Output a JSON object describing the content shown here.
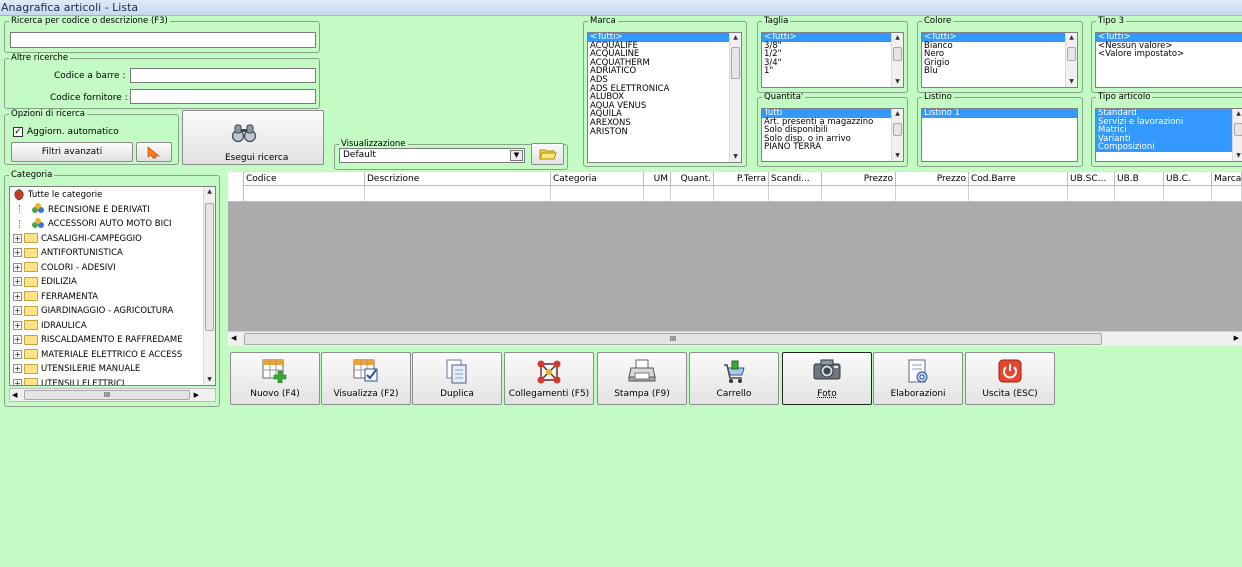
{
  "window": {
    "title": "Anagrafica articoli  - Lista"
  },
  "search": {
    "legend": "Ricerca per codice o descrizione (F3)",
    "value": ""
  },
  "other": {
    "legend": "Altre ricerche",
    "barcode_label": "Codice a barre :",
    "barcode_value": "",
    "supplier_label": "Codice fornitore :",
    "supplier_value": ""
  },
  "options": {
    "legend": "Opzioni di ricerca",
    "auto_update_label": "Aggiorn. automatico",
    "auto_update_checked": true,
    "advanced_filters_label": "Filtri avanzati"
  },
  "search_button_label": "Esegui ricerca",
  "view": {
    "legend": "Visualizzazione",
    "selected": "Default"
  },
  "category": {
    "legend": "Categoria",
    "items": [
      {
        "label": "Tutte le categorie",
        "type": "root"
      },
      {
        "label": "RECINSIONE E DERIVATI",
        "type": "special"
      },
      {
        "label": "ACCESSORI AUTO MOTO BICI",
        "type": "special"
      },
      {
        "label": "CASALIGHI-CAMPEGGIO",
        "type": "folder"
      },
      {
        "label": "ANTIFORTUNISTICA",
        "type": "folder"
      },
      {
        "label": "COLORI - ADESIVI",
        "type": "folder"
      },
      {
        "label": "EDILIZIA",
        "type": "folder"
      },
      {
        "label": "FERRAMENTA",
        "type": "folder"
      },
      {
        "label": "GIARDINAGGIO - AGRICOLTURA",
        "type": "folder"
      },
      {
        "label": "IDRAULICA",
        "type": "folder"
      },
      {
        "label": "RISCALDAMENTO E RAFFREDAME",
        "type": "folder"
      },
      {
        "label": "MATERIALE ELETTRICO E ACCESS",
        "type": "folder"
      },
      {
        "label": "UTENSILERIE MANUALE",
        "type": "folder"
      },
      {
        "label": "UTENSILI ELETTRICI",
        "type": "folder"
      }
    ],
    "hscroll_label": "III"
  },
  "marca": {
    "legend": "Marca",
    "items": [
      "<Tutti>",
      "ACQUALIFE",
      "ACQUALINE",
      "ACQUATHERM",
      "ADRIATICO",
      "ADS",
      "ADS ELETTRONICA",
      "ALUBOX",
      "AQUA  VENUS",
      "AQUILA",
      "AREXONS",
      "ARISTON"
    ],
    "selected": [
      "<Tutti>"
    ]
  },
  "taglia": {
    "legend": "Taglia",
    "items": [
      "<Tutti>",
      "3/8\"",
      "1/2\"",
      "3/4\"",
      "1\""
    ],
    "selected": [
      "<Tutti>"
    ]
  },
  "colore": {
    "legend": "Colore",
    "items": [
      "<Tutti>",
      "Bianco",
      "Nero",
      "Grigio",
      "Blu"
    ],
    "selected": [
      "<Tutti>"
    ]
  },
  "tipo3": {
    "legend": "Tipo 3",
    "items": [
      "<Tutti>",
      "<Nessun valore>",
      "<Valore impostato>"
    ],
    "selected": [
      "<Tutti>"
    ]
  },
  "quantita": {
    "legend": "Quantita'",
    "items": [
      "Tutti",
      "Art. presenti a magazzino",
      "Solo disponibili",
      "Solo disp. o in arrivo",
      "PIANO TERRA"
    ],
    "selected": [
      "Tutti"
    ]
  },
  "listino": {
    "legend": "Listino",
    "items": [
      "Listino 1"
    ],
    "selected": [
      "Listino 1"
    ]
  },
  "tipo_articolo": {
    "legend": "Tipo articolo",
    "items": [
      "Standard",
      "Servizi e lavorazioni",
      "Matrici",
      "Varianti",
      "Composizioni"
    ],
    "selected": [
      "Standard",
      "Servizi e lavorazioni",
      "Matrici",
      "Varianti",
      "Composizioni"
    ]
  },
  "grid": {
    "columns": [
      "Codice",
      "Descrizione",
      "Categoria",
      "UM",
      "Quant.",
      "P.Terra",
      "Scandi...",
      "Prezzo",
      "Prezzo",
      "Cod.Barre",
      "UB.SC...",
      "UB.B",
      "UB.C.",
      "Marca"
    ],
    "hscroll_label": "III"
  },
  "actions": [
    {
      "label": "Nuovo (F4)",
      "icon": "new-icon"
    },
    {
      "label": "Visualizza (F2)",
      "icon": "view-icon"
    },
    {
      "label": "Duplica",
      "icon": "duplicate-icon"
    },
    {
      "label": "Collegamenti (F5)",
      "icon": "links-icon"
    },
    {
      "label": "Stampa (F9)",
      "icon": "printer-icon"
    },
    {
      "label": "Carrello",
      "icon": "cart-icon"
    },
    {
      "label": "Foto",
      "icon": "camera-icon"
    },
    {
      "label": "Elaborazioni",
      "icon": "processing-icon"
    },
    {
      "label": "Uscita (ESC)",
      "icon": "power-icon"
    }
  ],
  "colors": {
    "background": "#c4fac4",
    "selection": "#3399ff"
  }
}
